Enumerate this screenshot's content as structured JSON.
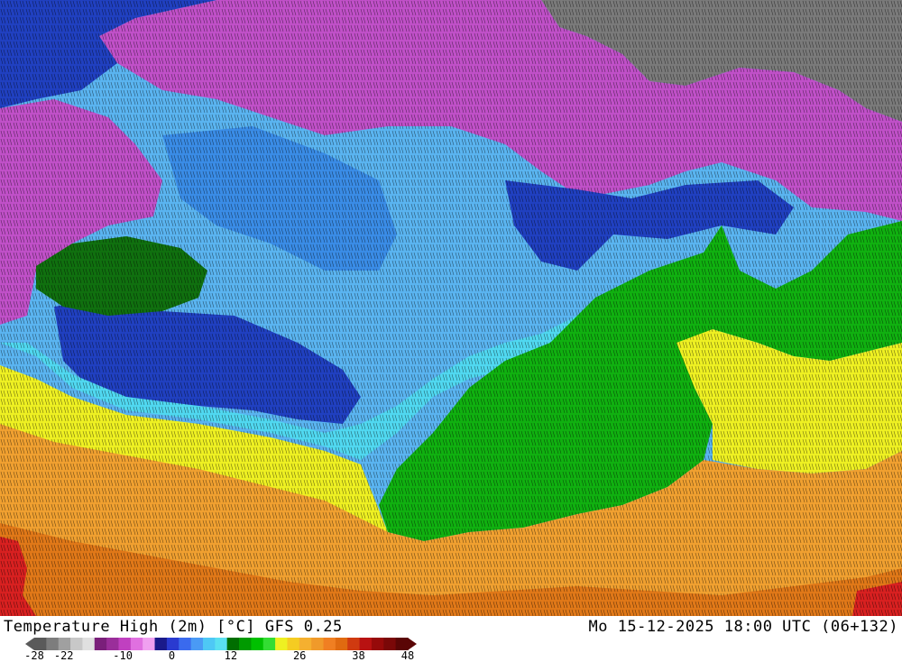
{
  "footer": {
    "title": "Temperature High (2m) [°C] GFS 0.25",
    "valid_time": "Mo 15-12-2025 18:00 UTC (06+132)"
  },
  "legend": {
    "ticks": [
      "-28",
      "-22",
      "-10",
      "0",
      "12",
      "26",
      "38",
      "48"
    ],
    "range": [
      -28,
      48
    ],
    "colors": [
      "#5a5a5a",
      "#7d7d7d",
      "#a0a0a0",
      "#c8c8c8",
      "#e0e0e0",
      "#7a1f7a",
      "#9a2e9a",
      "#c040c0",
      "#e070e0",
      "#f0a0f0",
      "#1a1a8a",
      "#2a3ad0",
      "#3a6aee",
      "#4a9af5",
      "#4ec8f5",
      "#5ae0f0",
      "#006e00",
      "#009a00",
      "#00c000",
      "#33dd33",
      "#eef022",
      "#f5cc22",
      "#f5b030",
      "#f09a2a",
      "#f07f22",
      "#e06a10",
      "#d03a10",
      "#b81212",
      "#960a0a",
      "#7a0808",
      "#5a0505"
    ]
  },
  "map": {
    "colors": {
      "cold_gray": "#7a7a7a",
      "violet": "#c050c8",
      "dark_blue": "#2040c0",
      "blue": "#3a8ce6",
      "light_blue": "#5ab4f0",
      "cyan": "#50d8f0",
      "dark_green": "#10700f",
      "green": "#10b010",
      "yellow": "#eef022",
      "orange": "#f0a030",
      "dark_orange": "#e07818",
      "red": "#d82020"
    }
  }
}
